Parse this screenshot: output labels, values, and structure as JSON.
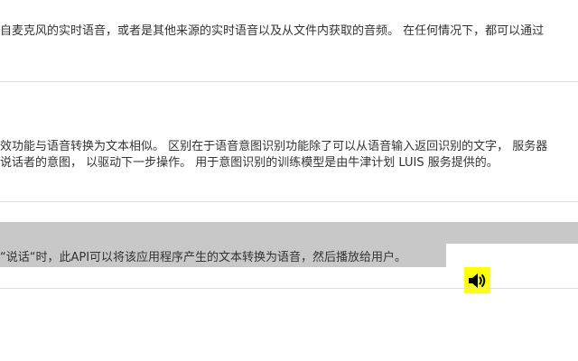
{
  "section1": {
    "line1": "自麦克风的实时语音，或者是其他来源的实时语音以及从文件内获取的音频。 在任何情况下，都可以通过"
  },
  "section2": {
    "line1": "效功能与语音转换为文本相似。 区别在于语音意图识别功能除了可以从语音输入返回识别的文字， 服务器",
    "line2": "说话者的意图， 以驱动下一步操作。 用于意图识别的训练模型是由牛津计划 LUIS 服务提供的。"
  },
  "section3": {
    "line1": "“说话“时，此API可以将该应用程序产生的文本转换为语音，然后播放给用户。"
  },
  "speaker": {
    "icon": "speaker-icon",
    "color": "#ffff00"
  },
  "colors": {
    "text": "#333333",
    "divider": "#dddddd",
    "highlight": "#c8c8c8"
  }
}
